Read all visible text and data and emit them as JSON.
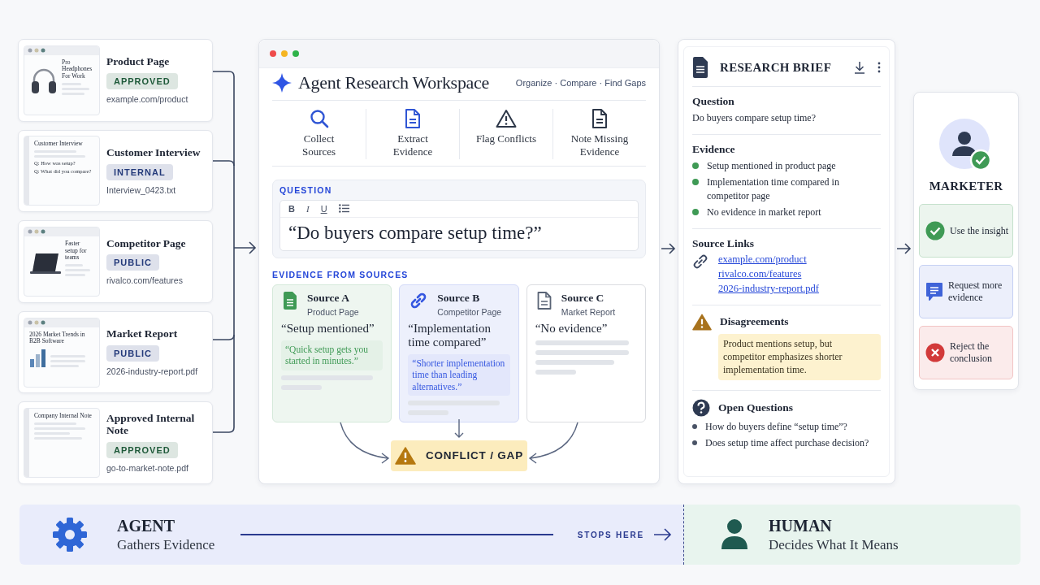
{
  "sources": [
    {
      "title": "Product Page",
      "badge": {
        "text": "APPROVED",
        "color": "#1f5a3a"
      },
      "file": "example.com/product",
      "thumbnail": {
        "kind": "product",
        "title": "Pro Headphones For Work"
      }
    },
    {
      "title": "Customer Interview",
      "badge": {
        "text": "INTERNAL",
        "color": "#243a7a"
      },
      "file": "Interview_0423.txt",
      "thumbnail": {
        "kind": "interview",
        "title": "Customer Interview",
        "questions": [
          "Q:  How was setup?",
          "Q:  What did you compare?"
        ]
      }
    },
    {
      "title": "Competitor Page",
      "badge": {
        "text": "PUBLIC",
        "color": "#243a7a"
      },
      "file": "rivalco.com/features",
      "thumbnail": {
        "kind": "competitor",
        "title": "Faster setup for teams"
      }
    },
    {
      "title": "Market Report",
      "badge": {
        "text": "PUBLIC",
        "color": "#243a7a"
      },
      "file": "2026-industry-report.pdf",
      "thumbnail": {
        "kind": "report",
        "title": "2026 Market Trends in B2B Software"
      }
    },
    {
      "title": "Approved Internal Note",
      "badge": {
        "text": "APPROVED",
        "color": "#1f5a3a"
      },
      "file": "go-to-market-note.pdf",
      "thumbnail": {
        "kind": "note",
        "title": "Company Internal Note"
      }
    }
  ],
  "workspace": {
    "title": "Agent Research Workspace",
    "tagline": "Organize · Compare · Find Gaps",
    "steps": [
      {
        "kind": "search",
        "label": "Collect Sources",
        "color": "#2f55d4"
      },
      {
        "kind": "document",
        "label": "Extract Evidence",
        "color": "#2f55d4"
      },
      {
        "kind": "warning",
        "label": "Flag Conflicts",
        "color": "#2d3748"
      },
      {
        "kind": "document",
        "label": "Note Missing Evidence",
        "color": "#2d3748"
      }
    ],
    "question": {
      "label": "QUESTION",
      "toolbar": [
        {
          "kind": "bold",
          "label": "B"
        },
        {
          "kind": "italic",
          "label": "I"
        },
        {
          "kind": "underline",
          "label": "U"
        },
        {
          "kind": "list"
        }
      ],
      "text": "“Do buyers compare setup time?”"
    },
    "evidence": {
      "label": "EVIDENCE FROM SOURCES",
      "sources": [
        {
          "kind": "sheet",
          "color": "#3f9a55",
          "name": "Source A",
          "type": "Product Page",
          "quote": "“Setup mentioned”",
          "excerpt": "“Quick setup gets you started in minutes.”"
        },
        {
          "kind": "link",
          "color": "#3557e0",
          "name": "Source B",
          "type": "Competitor Page",
          "quote": "“Implementation time compared”",
          "excerpt": "“Shorter implementation time than leading alternatives.”"
        },
        {
          "kind": "doc",
          "color": "#5a6476",
          "name": "Source C",
          "type": "Market Report",
          "quote": "“No evidence”"
        }
      ],
      "conflict": "CONFLICT / GAP"
    }
  },
  "brief": {
    "title": "RESEARCH BRIEF",
    "question": {
      "heading": "Question",
      "text": "Do buyers compare setup time?"
    },
    "evidence": {
      "heading": "Evidence",
      "items": [
        "Setup mentioned in product page",
        "Implementation time compared in competitor page",
        "No evidence in market report"
      ]
    },
    "links": {
      "heading": "Source Links",
      "items": [
        "example.com/product",
        "rivalco.com/features",
        "2026-industry-report.pdf"
      ]
    },
    "disagreements": {
      "heading": "Disagreements",
      "text": "Product mentions setup, but competitor emphasizes shorter implementation time."
    },
    "open_questions": {
      "heading": "Open Questions",
      "items": [
        "How do buyers define “setup time”?",
        "Does setup time affect purchase decision?"
      ]
    }
  },
  "marketer": {
    "role": "MARKETER",
    "actions": [
      {
        "kind": "approve",
        "label": "Use the insight"
      },
      {
        "kind": "request",
        "label": "Request more evidence"
      },
      {
        "kind": "reject",
        "label": "Reject the conclusion"
      }
    ]
  },
  "footer": {
    "agent": {
      "title": "AGENT",
      "subtitle": "Gathers Evidence"
    },
    "handoff": "STOPS HERE",
    "human": {
      "title": "HUMAN",
      "subtitle": "Decides What It Means"
    }
  }
}
